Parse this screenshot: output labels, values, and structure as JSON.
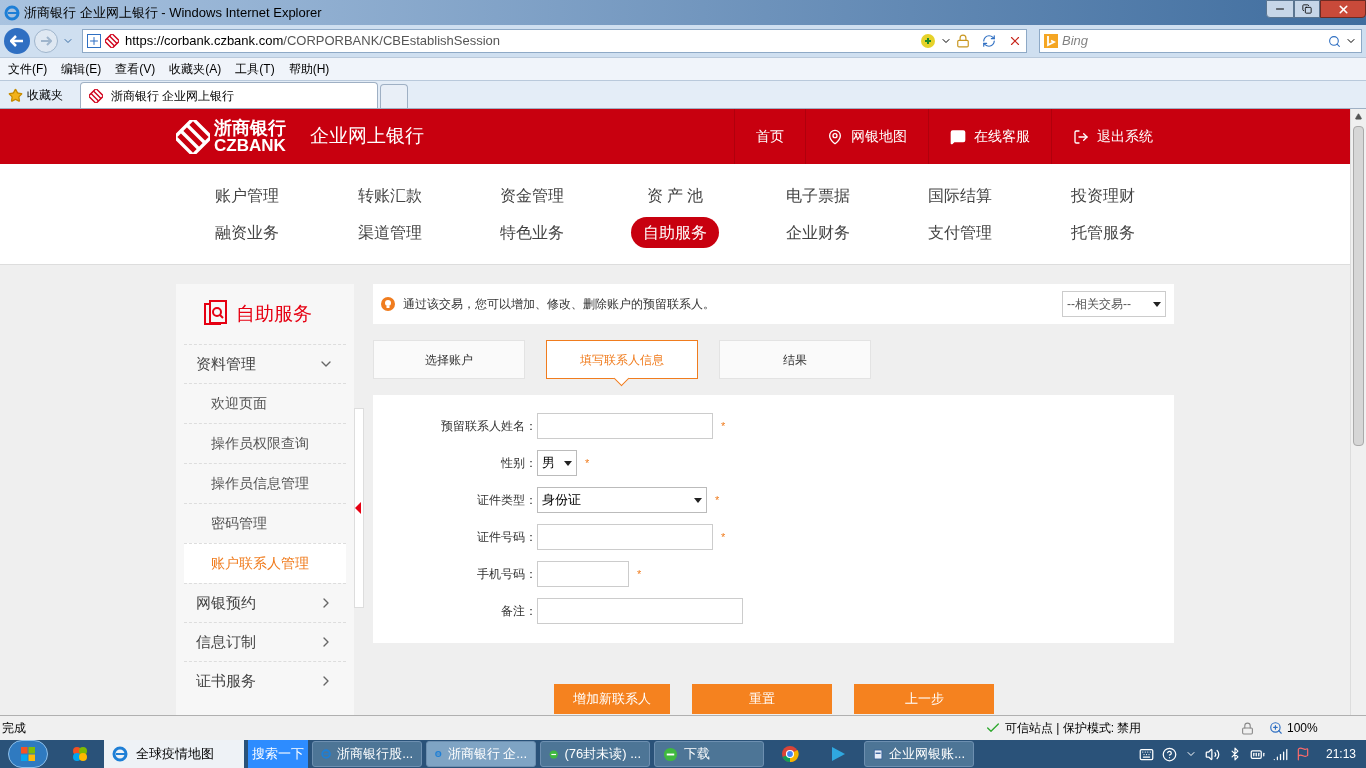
{
  "window": {
    "title": "浙商银行 企业网上银行 - Windows Internet Explorer"
  },
  "address": {
    "host_prefix": "https://corbank.",
    "host": "czbank.com",
    "path": "/CORPORBANK/CBEstablishSession"
  },
  "search": {
    "placeholder": "Bing"
  },
  "menu": [
    "文件(F)",
    "编辑(E)",
    "查看(V)",
    "收藏夹(A)",
    "工具(T)",
    "帮助(H)"
  ],
  "favorites": {
    "label": "收藏夹"
  },
  "tabs": [
    {
      "label": "浙商银行 企业网上银行",
      "selected": true
    }
  ],
  "page": {
    "brand": {
      "name": "浙商银行",
      "latin": "CZBANK",
      "product": "企业网上银行"
    },
    "header_links": [
      {
        "label": "首页",
        "kind": "none"
      },
      {
        "label": "网银地图",
        "kind": "map"
      },
      {
        "label": "在线客服",
        "kind": "chat"
      },
      {
        "label": "退出系统",
        "kind": "exit"
      }
    ],
    "nav": [
      {
        "label": "账户管理",
        "selected": false
      },
      {
        "label": "转账汇款",
        "selected": false
      },
      {
        "label": "资金管理",
        "selected": false
      },
      {
        "label": "资 产 池",
        "selected": false
      },
      {
        "label": "电子票据",
        "selected": false
      },
      {
        "label": "国际结算",
        "selected": false
      },
      {
        "label": "投资理财",
        "selected": false
      },
      {
        "label": "融资业务",
        "selected": false
      },
      {
        "label": "渠道管理",
        "selected": false
      },
      {
        "label": "特色业务",
        "selected": false
      },
      {
        "label": "自助服务",
        "selected": true
      },
      {
        "label": "企业财务",
        "selected": false
      },
      {
        "label": "支付管理",
        "selected": false
      },
      {
        "label": "托管服务",
        "selected": false
      }
    ],
    "sidebar": {
      "title": "自助服务",
      "items": [
        {
          "label": "资料管理",
          "expanded": true,
          "children": [
            {
              "label": "欢迎页面",
              "selected": false
            },
            {
              "label": "操作员权限查询",
              "selected": false
            },
            {
              "label": "操作员信息管理",
              "selected": false
            },
            {
              "label": "密码管理",
              "selected": false
            },
            {
              "label": "账户联系人管理",
              "selected": true
            }
          ]
        },
        {
          "label": "网银预约",
          "expanded": false
        },
        {
          "label": "信息订制",
          "expanded": false
        },
        {
          "label": "证书服务",
          "expanded": false
        }
      ]
    },
    "notice": "通过该交易，您可以增加、修改、删除账户的预留联系人。",
    "related": {
      "value": "--相关交易--"
    },
    "steps": [
      {
        "label": "选择账户",
        "selected": false
      },
      {
        "label": "填写联系人信息",
        "selected": true
      },
      {
        "label": "结果",
        "selected": false
      }
    ],
    "form": [
      {
        "label": "预留联系人姓名：",
        "kind": "text",
        "required_mark": "*"
      },
      {
        "label": "性别：",
        "kind": "select",
        "value": "男",
        "required_mark": "*"
      },
      {
        "label": "证件类型：",
        "kind": "select",
        "value": "身份证",
        "required_mark": "*"
      },
      {
        "label": "证件号码：",
        "kind": "text",
        "required_mark": "*"
      },
      {
        "label": "手机号码：",
        "kind": "text",
        "required_mark": "*"
      },
      {
        "label": "备注：",
        "kind": "text"
      }
    ],
    "buttons": [
      "增加新联系人",
      "重置",
      "上一步"
    ]
  },
  "status_bar": {
    "text": "完成",
    "zone": "可信站点 | 保护模式: 禁用",
    "zoom": "100%"
  },
  "taskbar": {
    "items": [
      {
        "kind": "plate",
        "label": "全球疫情地图",
        "selected": false
      },
      {
        "kind": "search",
        "label": "搜索一下",
        "selected": false
      },
      {
        "kind": "ie",
        "label": "浙商银行股...",
        "selected": false
      },
      {
        "kind": "ie",
        "label": "浙商银行 企...",
        "selected": true
      },
      {
        "kind": "mail",
        "label": "(76封未读) ...",
        "selected": false
      },
      {
        "kind": "mail",
        "label": "下载",
        "selected": false
      },
      {
        "kind": "chrome",
        "selected": false
      },
      {
        "kind": "player",
        "selected": false
      },
      {
        "kind": "word",
        "label": "企业网银账...",
        "selected": false
      }
    ],
    "clock": "21:13"
  }
}
